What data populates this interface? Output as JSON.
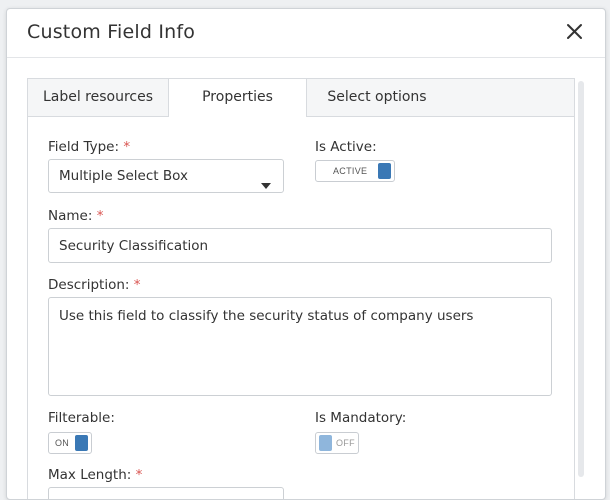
{
  "modal": {
    "title": "Custom Field Info",
    "close_icon": "close-icon"
  },
  "tabs": [
    {
      "label": "Label resources",
      "active": false
    },
    {
      "label": "Properties",
      "active": true
    },
    {
      "label": "Select options",
      "active": false
    }
  ],
  "form": {
    "required_marker": "*",
    "field_type": {
      "label": "Field Type:",
      "value": "Multiple Select Box",
      "icon": "caret-down-icon"
    },
    "is_active": {
      "label": "Is Active:",
      "toggle_text": "ACTIVE",
      "state": true
    },
    "name": {
      "label": "Name:",
      "value": "Security Classification"
    },
    "description": {
      "label": "Description:",
      "value": "Use this field to classify the security status of company users"
    },
    "filterable": {
      "label": "Filterable:",
      "toggle_text": "ON",
      "state": true
    },
    "is_mandatory": {
      "label": "Is Mandatory:",
      "toggle_text": "OFF",
      "state": false
    },
    "max_length": {
      "label": "Max Length:"
    }
  },
  "colors": {
    "toggle_on": "#3a78b5",
    "toggle_off": "#8fb6dc",
    "required": "#d9534f"
  }
}
